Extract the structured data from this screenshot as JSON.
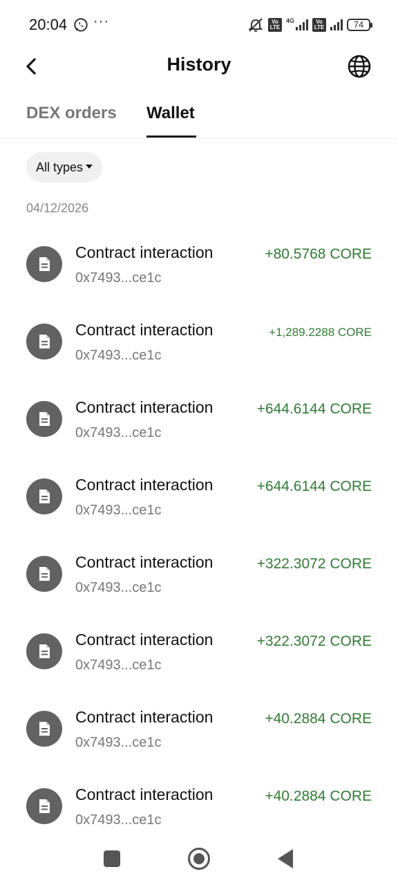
{
  "status_bar": {
    "time": "20:04",
    "dots": "···",
    "volte1": "Vo LTE",
    "net": "4G",
    "volte2": "Vo LTE",
    "battery": "74"
  },
  "header": {
    "title": "History",
    "back_icon": "chevron-left-icon",
    "globe_icon": "globe-icon"
  },
  "tabs": [
    {
      "label": "DEX orders",
      "active": false
    },
    {
      "label": "Wallet",
      "active": true
    }
  ],
  "filter": {
    "label": "All types"
  },
  "date_group": "04/12/2026",
  "transactions": [
    {
      "title": "Contract interaction",
      "address": "0x7493...ce1c",
      "amount": "+80.5768 CORE"
    },
    {
      "title": "Contract interaction",
      "address": "0x7493...ce1c",
      "amount": "+1,289.2288 CORE"
    },
    {
      "title": "Contract interaction",
      "address": "0x7493...ce1c",
      "amount": "+644.6144 CORE"
    },
    {
      "title": "Contract interaction",
      "address": "0x7493...ce1c",
      "amount": "+644.6144 CORE"
    },
    {
      "title": "Contract interaction",
      "address": "0x7493...ce1c",
      "amount": "+322.3072 CORE"
    },
    {
      "title": "Contract interaction",
      "address": "0x7493...ce1c",
      "amount": "+322.3072 CORE"
    },
    {
      "title": "Contract interaction",
      "address": "0x7493...ce1c",
      "amount": "+40.2884 CORE"
    },
    {
      "title": "Contract interaction",
      "address": "0x7493...ce1c",
      "amount": "+40.2884 CORE"
    }
  ],
  "colors": {
    "positive_amount": "#2e7d32",
    "icon_bg": "#626262"
  }
}
